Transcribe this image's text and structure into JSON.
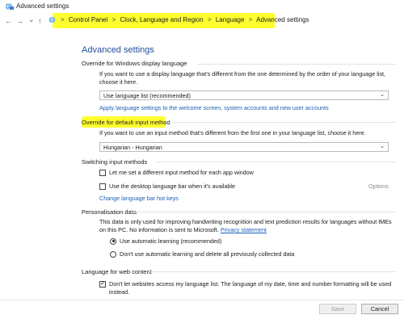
{
  "window": {
    "title": "Advanced settings"
  },
  "nav": {
    "back": "←",
    "forward": "→",
    "dropdown": "⌄",
    "up": "↑",
    "breadcrumb": [
      "Control Panel",
      "Clock, Language and Region",
      "Language",
      "Advanced settings"
    ],
    "separator": ">"
  },
  "page": {
    "heading": "Advanced settings"
  },
  "display_language": {
    "label": "Override for Windows display language",
    "desc": "If you want to use a display language that's different from the one determined by the order of your language list, choose it here.",
    "selected": "Use language list (recommended)",
    "link": "Apply language settings to the welcome screen, system accounts and new user accounts"
  },
  "input_method": {
    "label": "Override for default input method",
    "desc": "If you want to use an input method that's different from the first one in your language list, choose it here.",
    "selected": "Hungarian - Hungarian"
  },
  "switching": {
    "label": "Switching input methods",
    "opt1": "Let me set a different input method for each app window",
    "opt1_checked": false,
    "opt2": "Use the desktop language bar when it's available",
    "opt2_checked": false,
    "options_link": "Options",
    "hotkeys_link": "Change language bar hot keys"
  },
  "personalisation": {
    "label": "Personalisation data",
    "desc_main": "This data is only used for improving handwriting recognition and text prediction results for languages without IMEs on this PC. No information is sent to Microsoft.",
    "privacy_link": "Privacy statement",
    "radio1": "Use automatic learning (recommended)",
    "radio2": "Don't use automatic learning and delete all previously collected data",
    "selected": "radio1"
  },
  "web_content": {
    "label": "Language for web content",
    "checkbox": "Don't let websites access my language list. The language of my date, time and number formatting will be used instead.",
    "checked": true
  },
  "footer": {
    "save": "Save",
    "cancel": "Cancel"
  },
  "colors": {
    "highlight": "#ffff30",
    "heading": "#1e4f9c",
    "link": "#1a5fb4"
  }
}
